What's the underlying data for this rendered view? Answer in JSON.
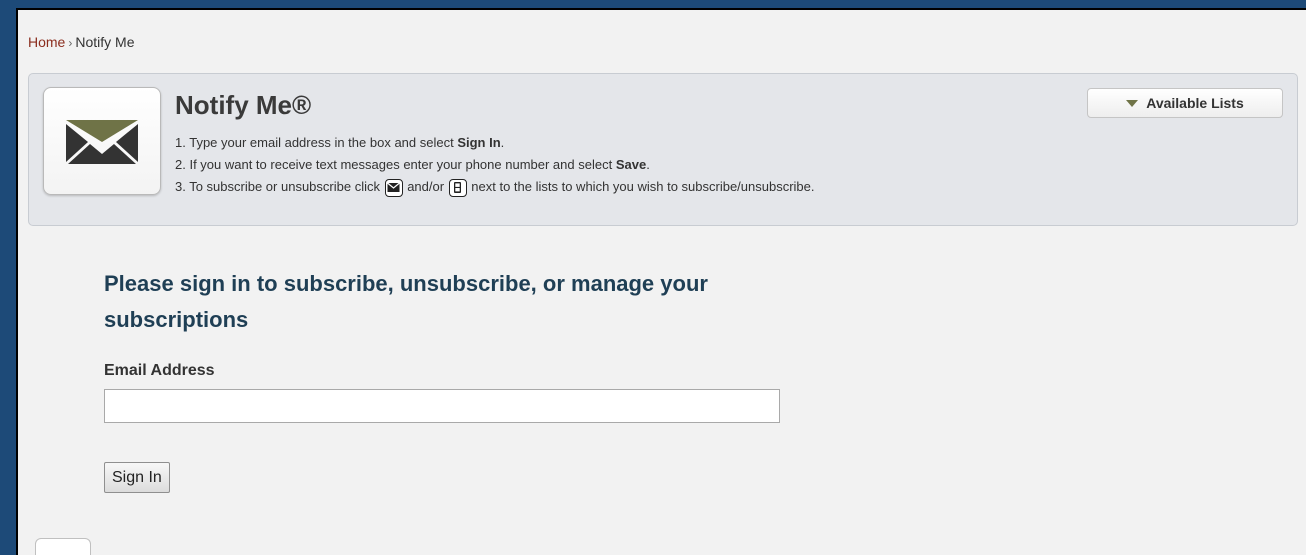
{
  "breadcrumb": {
    "home": "Home",
    "separator": "›",
    "current": "Notify Me"
  },
  "header": {
    "title": "Notify Me®",
    "icon": "envelope-icon",
    "available_lists_label": "Available Lists"
  },
  "steps": {
    "s1_prefix": "1. Type your email address in the box and select ",
    "s1_bold": "Sign In",
    "s1_suffix": ".",
    "s2_prefix": "2. If you want to receive text messages enter your phone number and select ",
    "s2_bold": "Save",
    "s2_suffix": ".",
    "s3_prefix": "3. To subscribe or unsubscribe click ",
    "s3_mid": " and/or ",
    "s3_suffix": " next to the lists to which you wish to subscribe/unsubscribe."
  },
  "signin": {
    "heading": "Please sign in to subscribe, unsubscribe, or manage your subscriptions",
    "email_label": "Email Address",
    "email_value": "",
    "button_label": "Sign In"
  },
  "colors": {
    "accent": "#8b2d1e",
    "heading": "#1f3f55",
    "icon": "#6f7347"
  }
}
